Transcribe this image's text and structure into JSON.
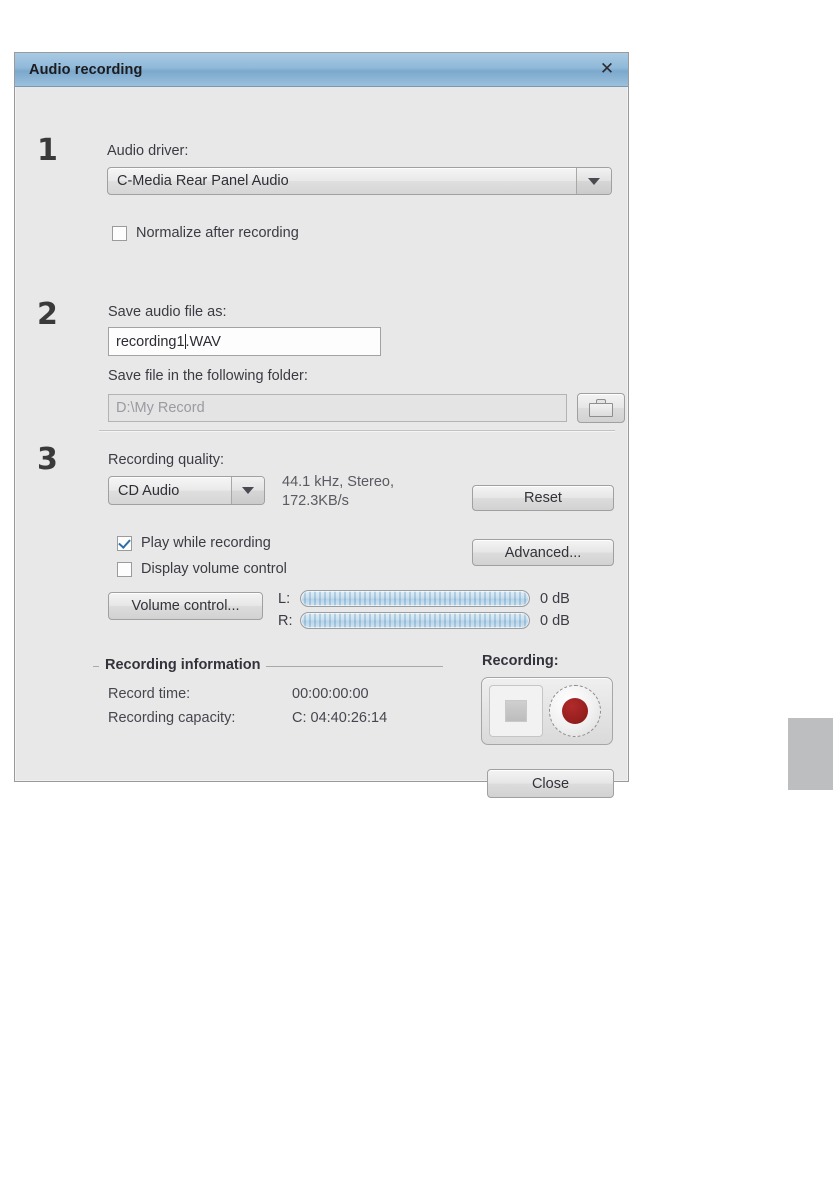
{
  "window": {
    "title": "Audio recording",
    "close_icon": "close-x-icon"
  },
  "steps": {
    "one": "1",
    "two": "2",
    "three": "3"
  },
  "step1": {
    "driver_label": "Audio driver:",
    "driver_value": "C-Media Rear Panel Audio",
    "driver_arrow_icon": "chevron-down-icon",
    "normalize_label": "Normalize after recording",
    "normalize_checked": false
  },
  "step2": {
    "save_as_label": "Save audio file as:",
    "filename_before_caret": "recording1",
    "filename_after_caret": ".WAV",
    "filename_full": "recording1.WAV",
    "folder_label": "Save file in the following folder:",
    "folder_value": "D:\\My Record",
    "browse_icon": "folder-icon"
  },
  "step3": {
    "quality_label": "Recording quality:",
    "quality_value": "CD Audio",
    "quality_arrow_icon": "chevron-down-icon",
    "quality_info_line1": "44.1 kHz, Stereo,",
    "quality_info_line2": "172.3KB/s",
    "reset_label": "Reset",
    "advanced_label": "Advanced...",
    "play_while_recording_label": "Play while recording",
    "play_while_recording_checked": true,
    "display_volume_label": "Display volume control",
    "display_volume_checked": false,
    "volume_control_label": "Volume control...",
    "meter_left_label": "L:",
    "meter_right_label": "R:",
    "meter_left_value": "0 dB",
    "meter_right_value": "0 dB"
  },
  "recording_information": {
    "group_title": "Recording information",
    "record_time_key": "Record time:",
    "record_time_value": "00:00:00:00",
    "capacity_key": "Recording capacity:",
    "capacity_value": "C: 04:40:26:14"
  },
  "transport": {
    "heading": "Recording:",
    "stop_icon": "stop-square-icon",
    "record_icon": "record-circle-icon"
  },
  "footer": {
    "close_label": "Close"
  },
  "colors": {
    "titlebar_accent": "#8fb8d8",
    "dialog_bg": "#e8e8e8",
    "record_red": "#991f1f",
    "check_blue": "#2f6ea8",
    "edge_block": "#bcbec0"
  }
}
